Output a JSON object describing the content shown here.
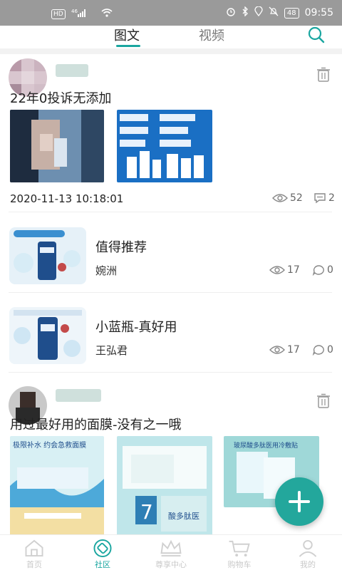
{
  "status_bar": {
    "badge_hd": "HD",
    "badge_signal": "⁴⁶",
    "battery": "48",
    "time": "09:55"
  },
  "tabs": [
    {
      "label": "图文",
      "active": true
    },
    {
      "label": "视频",
      "active": false
    }
  ],
  "posts": [
    {
      "type": "image_post",
      "title": "22年0投诉无添加",
      "time": "2020-11-13 10:18:01",
      "views": "52",
      "comments": "2"
    },
    {
      "type": "article",
      "title": "值得推荐",
      "author": "婉洲",
      "views": "17",
      "comments": "0"
    },
    {
      "type": "article",
      "title": "小蓝瓶-真好用",
      "author": "王弘君",
      "views": "17",
      "comments": "0"
    },
    {
      "type": "image_post",
      "title": "用过最好用的面膜-没有之一哦",
      "thumb_text_1": "极限补水 约会急救面膜",
      "thumb_text_2": "酸多肽医",
      "thumb_text_3": "玻尿酸多肽医用冷敷贴"
    }
  ],
  "bottom_nav": [
    {
      "label": "首页",
      "icon": "home-icon",
      "active": false
    },
    {
      "label": "社区",
      "icon": "community-icon",
      "active": true
    },
    {
      "label": "尊享中心",
      "icon": "crown-icon",
      "active": false
    },
    {
      "label": "购物车",
      "icon": "cart-icon",
      "active": false
    },
    {
      "label": "我的",
      "icon": "user-icon",
      "active": false
    }
  ],
  "colors": {
    "accent": "#1aa6a0",
    "fab": "#23a79c"
  }
}
